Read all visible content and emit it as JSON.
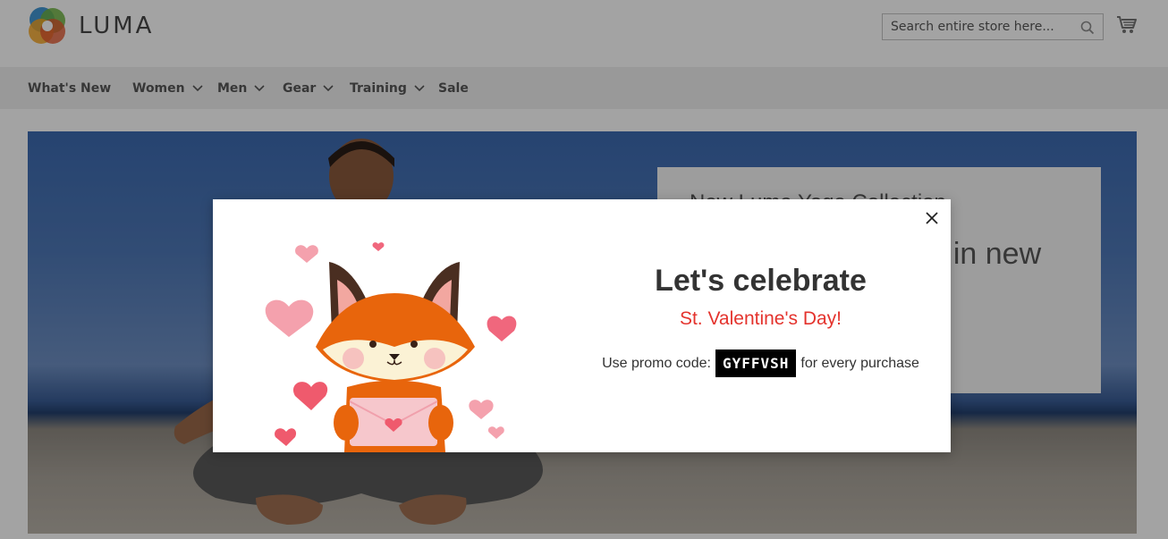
{
  "header": {
    "logo_text": "LUMA",
    "search_placeholder": "Search entire store here..."
  },
  "nav": {
    "items": [
      {
        "label": "What's New"
      },
      {
        "label": "Women"
      },
      {
        "label": "Men"
      },
      {
        "label": "Gear"
      },
      {
        "label": "Training"
      },
      {
        "label": "Sale"
      }
    ]
  },
  "hero": {
    "small_text": "New Luma Yoga Collection",
    "big_text": "Get fit and look fab in new"
  },
  "modal": {
    "title": "Let's celebrate",
    "subtitle": "St. Valentine's Day!",
    "promo_prefix": "Use promo code:",
    "promo_code": "GYFFVSH",
    "promo_suffix": "for every purchase"
  },
  "colors": {
    "accent_red": "#e4332d",
    "fox_orange": "#e8650c",
    "heart_pink": "#f0677d"
  }
}
